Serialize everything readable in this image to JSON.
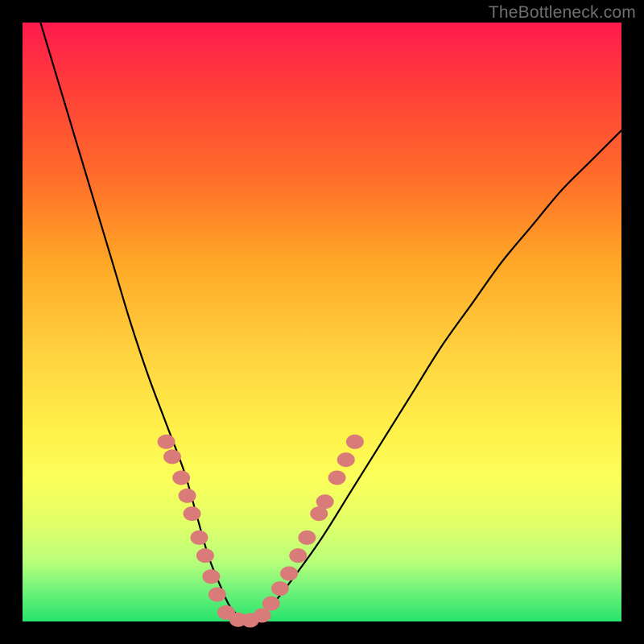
{
  "watermark": "TheBottleneck.com",
  "chart_data": {
    "type": "line",
    "title": "",
    "xlabel": "",
    "ylabel": "",
    "xlim": [
      0,
      100
    ],
    "ylim": [
      0,
      100
    ],
    "series": [
      {
        "name": "bottleneck-curve",
        "x": [
          3,
          6,
          9,
          12,
          15,
          18,
          21,
          24,
          27,
          29,
          31,
          33,
          35,
          38,
          41,
          45,
          50,
          55,
          60,
          65,
          70,
          75,
          80,
          85,
          90,
          95,
          100
        ],
        "y": [
          100,
          90,
          80,
          70,
          60,
          50,
          41,
          33,
          25,
          18,
          11,
          6,
          2,
          0,
          2,
          7,
          14,
          22,
          30,
          38,
          46,
          53,
          60,
          66,
          72,
          77,
          82
        ]
      }
    ],
    "markers": {
      "name": "highlight-dots",
      "color": "#d97b78",
      "points": [
        {
          "x": 24.0,
          "y": 30.0
        },
        {
          "x": 25.0,
          "y": 27.5
        },
        {
          "x": 26.5,
          "y": 24.0
        },
        {
          "x": 27.5,
          "y": 21.0
        },
        {
          "x": 28.3,
          "y": 18.0
        },
        {
          "x": 29.5,
          "y": 14.0
        },
        {
          "x": 30.5,
          "y": 11.0
        },
        {
          "x": 31.5,
          "y": 7.5
        },
        {
          "x": 32.5,
          "y": 4.5
        },
        {
          "x": 34.0,
          "y": 1.5
        },
        {
          "x": 36.0,
          "y": 0.3
        },
        {
          "x": 38.0,
          "y": 0.2
        },
        {
          "x": 40.0,
          "y": 1.0
        },
        {
          "x": 41.5,
          "y": 3.0
        },
        {
          "x": 43.0,
          "y": 5.5
        },
        {
          "x": 44.5,
          "y": 8.0
        },
        {
          "x": 46.0,
          "y": 11.0
        },
        {
          "x": 47.5,
          "y": 14.0
        },
        {
          "x": 49.5,
          "y": 18.0
        },
        {
          "x": 50.5,
          "y": 20.0
        },
        {
          "x": 52.5,
          "y": 24.0
        },
        {
          "x": 54.0,
          "y": 27.0
        },
        {
          "x": 55.5,
          "y": 30.0
        }
      ]
    }
  }
}
